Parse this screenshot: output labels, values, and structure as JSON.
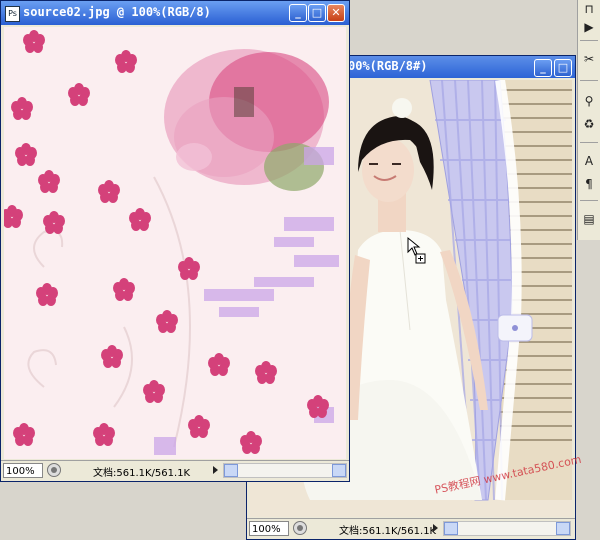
{
  "front_window": {
    "title": "source02.jpg @ 100%(RGB/8)",
    "doc_icon": "Ps",
    "zoom": "100%",
    "doc_info": "文档:561.1K/561.1K"
  },
  "back_window": {
    "title": "00%(RGB/8#)",
    "zoom": "100%",
    "doc_info": "文档:561.1K/561.1K"
  },
  "title_buttons": {
    "minimize": "_",
    "maximize": "□",
    "close": "✕"
  },
  "toolbox": {
    "tools": [
      "paint-bucket-icon",
      "play-icon",
      "scissors-icon",
      "stamp-icon",
      "history-brush-icon",
      "text-tool-icon",
      "paragraph-icon",
      "notes-icon"
    ],
    "glyphs": [
      "⊓",
      "▶",
      "✂",
      "⚲",
      "♻",
      "A",
      "¶",
      "▤"
    ]
  },
  "watermark": "PS教程网 www.tata580.com",
  "colors": {
    "titlebar": "#2a5fd3",
    "close": "#c74016",
    "flower_pink": "#d7407a",
    "lavender": "#c9a4e6"
  }
}
